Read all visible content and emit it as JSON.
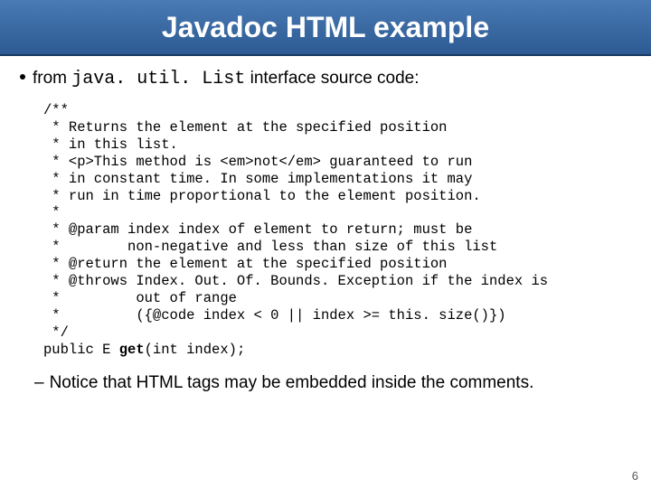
{
  "title": "Javadoc HTML example",
  "bullet": {
    "prefix": "from ",
    "mono": "java. util. List",
    "suffix": " interface source code:"
  },
  "code": {
    "l01": "/**",
    "l02": " * Returns the element at the specified position",
    "l03": " * in this list.",
    "l04": " * <p>This method is <em>not</em> guaranteed to run",
    "l05": " * in constant time. In some implementations it may",
    "l06": " * run in time proportional to the element position.",
    "l07": " *",
    "l08": " * @param index index of element to return; must be",
    "l09": " *        non-negative and less than size of this list",
    "l10": " * @return the element at the specified position",
    "l11": " * @throws Index. Out. Of. Bounds. Exception if the index is",
    "l12": " *         out of range",
    "l13": " *         ({@code index < 0 || index >= this. size()})",
    "l14": " */",
    "sig_pre": "public E ",
    "sig_bold": "get",
    "sig_post": "(int index);"
  },
  "subbullet": "Notice that HTML tags may be embedded inside the comments.",
  "page": "6"
}
